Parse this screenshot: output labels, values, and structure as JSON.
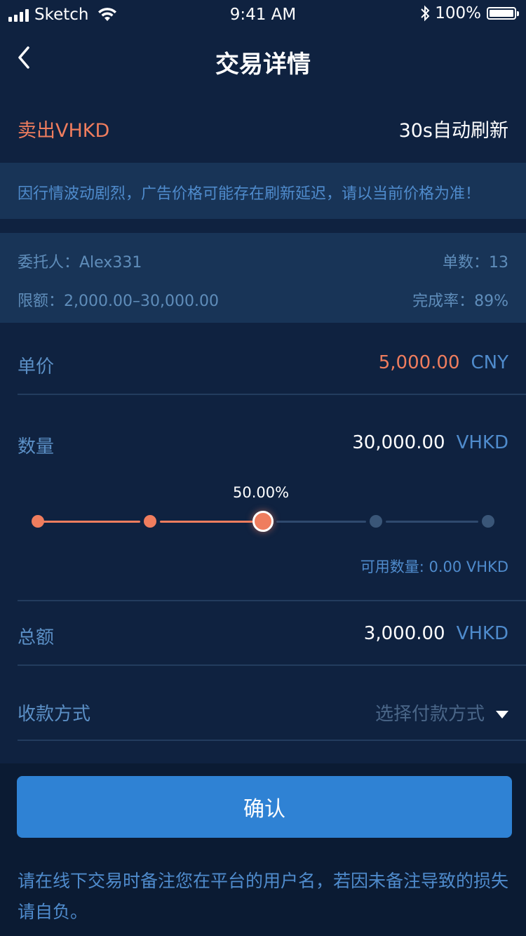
{
  "status_bar": {
    "carrier": "Sketch",
    "time": "9:41 AM",
    "battery": "100%",
    "icons": [
      "signal-icon",
      "wifi-icon",
      "bluetooth-icon",
      "battery-icon"
    ]
  },
  "nav": {
    "title": "交易详情",
    "back_icon": "chevron-left-icon"
  },
  "header": {
    "sell_label": "卖出VHKD",
    "refresh_label": "30s自动刷新"
  },
  "notice": "因行情波动剧烈，广告价格可能存在刷新延迟，请以当前价格为准！",
  "merchant": {
    "principal": "委托人：Alex331",
    "orders": "单数：13",
    "limit": "限额：2,000.00–30,000.00",
    "completion": "完成率：89%"
  },
  "price": {
    "label": "单价",
    "value": "5,000.00",
    "unit": "CNY"
  },
  "quantity": {
    "label": "数量",
    "value": "30,000.00",
    "unit": "VHKD",
    "slider_percent_text": "50.00%",
    "slider_fraction": 0.5,
    "available": "可用数量: 0.00 VHKD"
  },
  "total": {
    "label": "总额",
    "value": "3,000.00",
    "unit": "VHKD"
  },
  "payment": {
    "label": "收款方式",
    "placeholder": "选择付款方式",
    "icon": "caret-down-icon"
  },
  "confirm_label": "确认",
  "footer_note": "请在线下交易时备注您在平台的用户名，若因未备注导致的损失请自负。",
  "colors": {
    "background": "#0f2240",
    "accent_orange": "#ef7d5e",
    "accent_blue": "#2f82d4",
    "muted_blue": "#4f8bcc"
  }
}
